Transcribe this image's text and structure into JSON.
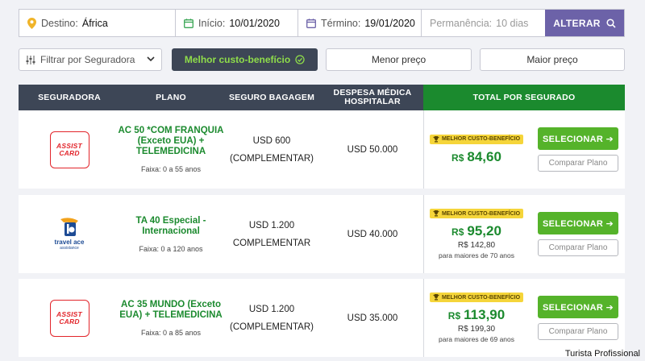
{
  "search": {
    "destino_label": "Destino:",
    "destino_value": "África",
    "inicio_label": "Início:",
    "inicio_value": "10/01/2020",
    "termino_label": "Término:",
    "termino_value": "19/01/2020",
    "permanencia_label": "Permanência:",
    "permanencia_value": "10 dias",
    "button_label": "ALTERAR"
  },
  "filters": {
    "seguradora_placeholder": "Filtrar por Seguradora",
    "best_label": "Melhor custo-benefício",
    "menor_label": "Menor preço",
    "maior_label": "Maior preço"
  },
  "table": {
    "headers": {
      "seguradora": "SEGURADORA",
      "plano": "PLANO",
      "bagagem": "SEGURO BAGAGEM",
      "despesa": "DESPESA MÉDICA HOSPITALAR",
      "total": "TOTAL POR SEGURADO"
    },
    "rows": [
      {
        "logo": "ASSIST CARD",
        "logo_line1": "ASSIST",
        "logo_line2": "CARD",
        "plan": "AC 50 *COM FRANQUIA (Exceto EUA) + TELEMEDICINA",
        "faixa": "Faixa: 0 a 55 anos",
        "bag_line1": "USD 600",
        "bag_line2": "(COMPLEMENTAR)",
        "despesa": "USD 50.000",
        "badge": "MELHOR CUSTO-BENEFÍCIO",
        "currency": "R$",
        "price": "84,60",
        "price_old": "",
        "price_note": "",
        "select_label": "SELECIONAR ➔",
        "compare_label": "Comparar Plano"
      },
      {
        "logo": "travel ace",
        "logo_line1": "travel ace",
        "logo_line2": "assistance",
        "plan": "TA 40 Especial - Internacional",
        "faixa": "Faixa: 0 a 120 anos",
        "bag_line1": "USD 1.200",
        "bag_line2": "COMPLEMENTAR",
        "despesa": "USD 40.000",
        "badge": "MELHOR CUSTO-BENEFÍCIO",
        "currency": "R$",
        "price": "95,20",
        "price_old": "R$ 142,80",
        "price_note": "para maiores de 70 anos",
        "select_label": "SELECIONAR ➔",
        "compare_label": "Comparar Plano"
      },
      {
        "logo": "ASSIST CARD",
        "logo_line1": "ASSIST",
        "logo_line2": "CARD",
        "plan": "AC 35 MUNDO (Exceto EUA) + TELEMEDICINA",
        "faixa": "Faixa: 0 a 85 anos",
        "bag_line1": "USD 1.200",
        "bag_line2": "(COMPLEMENTAR)",
        "despesa": "USD 35.000",
        "badge": "MELHOR CUSTO-BENEFÍCIO",
        "currency": "R$",
        "price": "113,90",
        "price_old": "R$ 199,30",
        "price_note": "para maiores de 69 anos",
        "select_label": "SELECIONAR ➔",
        "compare_label": "Comparar Plano"
      }
    ]
  },
  "watermark": "Turista Profissional",
  "colors": {
    "accent_purple": "#6c62a8",
    "header_dark": "#3d4656",
    "green": "#1b8a2e",
    "button_green": "#55b32a",
    "badge_yellow": "#f5d53a",
    "assist_red": "#e2252b"
  },
  "icons": {
    "destino": "location-pin-icon",
    "inicio": "calendar-icon",
    "termino": "calendar-icon",
    "alterar": "search-icon",
    "select": "chevron-down-icon",
    "best": "check-circle-icon",
    "badge": "trophy-icon"
  }
}
